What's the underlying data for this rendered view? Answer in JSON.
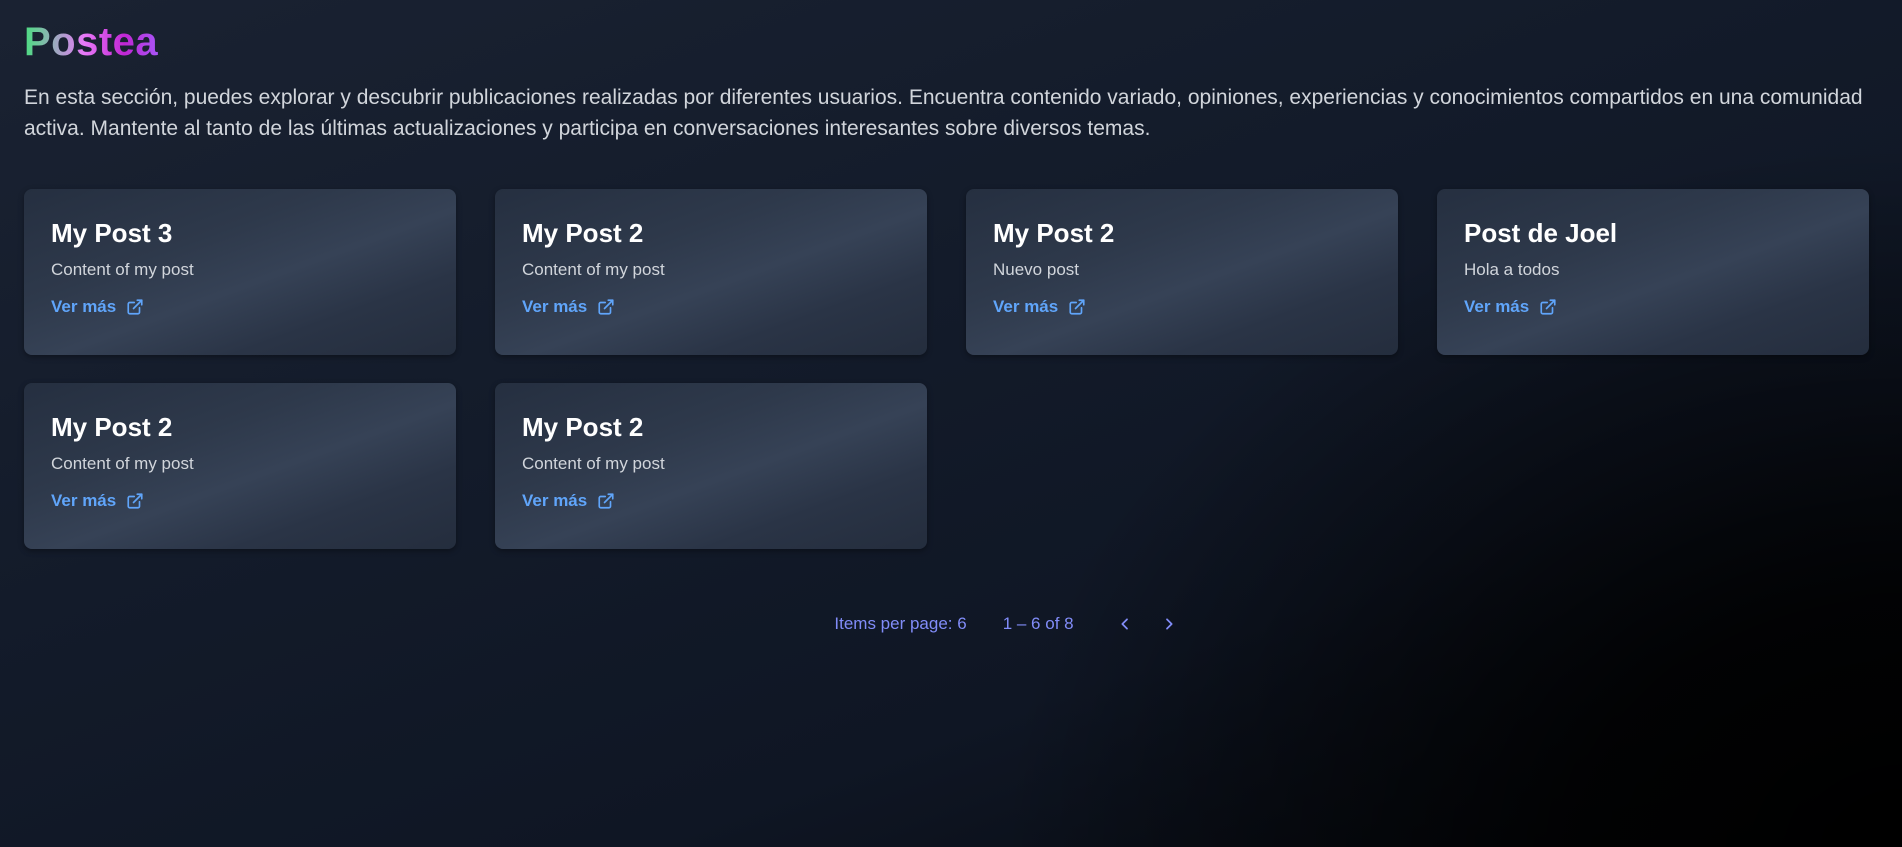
{
  "app": {
    "title": "Postea",
    "intro": "En esta sección, puedes explorar y descubrir publicaciones realizadas por diferentes usuarios. Encuentra contenido variado, opiniones, experiencias y conocimientos compartidos en una comunidad activa. Mantente al tanto de las últimas actualizaciones y participa en conversaciones interesantes sobre diversos temas."
  },
  "posts": [
    {
      "title": "My Post 3",
      "content": "Content of my post",
      "link_label": "Ver más",
      "link_icon": "external-link-icon"
    },
    {
      "title": "My Post 2",
      "content": "Content of my post",
      "link_label": "Ver más",
      "link_icon": "external-link-icon"
    },
    {
      "title": "My Post 2",
      "content": "Nuevo post",
      "link_label": "Ver más",
      "link_icon": "external-link-icon"
    },
    {
      "title": "Post de Joel",
      "content": "Hola a todos",
      "link_label": "Ver más",
      "link_icon": "external-link-icon"
    },
    {
      "title": "My Post 2",
      "content": "Content of my post",
      "link_label": "Ver más",
      "link_icon": "external-link-icon"
    },
    {
      "title": "My Post 2",
      "content": "Content of my post",
      "link_label": "Ver más",
      "link_icon": "external-link-icon"
    }
  ],
  "pagination": {
    "items_per_page_label": "Items per page: 6",
    "range_label": "1 – 6 of 8",
    "prev_icon": "chevron-left-icon",
    "next_icon": "chevron-right-icon"
  },
  "colors": {
    "link": "#60a5fa",
    "pagination": "#818cf8",
    "card_bg": "#2e394b",
    "brand_gradient": [
      "#4ade80",
      "#e879f9",
      "#a855f7"
    ]
  }
}
